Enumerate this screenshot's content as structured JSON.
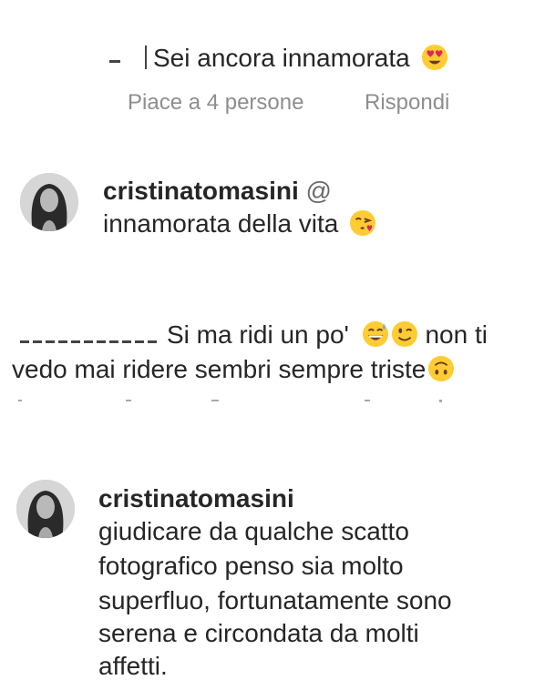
{
  "comment1": {
    "text": "Sei ancora innamorata",
    "emoji": "smiling-face-with-heart-eyes-icon",
    "likes_label": "Piace a 4 persone",
    "reply_label": "Rispondi"
  },
  "reply1": {
    "username": "cristinatomasini",
    "mention_prefix": "@",
    "text": "innamorata della vita",
    "emoji": "face-blowing-a-kiss-icon"
  },
  "comment2": {
    "line1": "Si ma ridi un po'",
    "line1_after": "non ti",
    "line2": "vedo mai ridere sembri sempre triste",
    "emojis": [
      "grinning-face-with-sweat-icon",
      "winking-face-icon",
      "upside-down-face-icon"
    ]
  },
  "reply2": {
    "username": "cristinatomasini",
    "lines": [
      "giudicare da qualche scatto",
      "fotografico penso sia molto",
      "superfluo, fortunatamente sono",
      "serena e circondata da molti",
      "affetti."
    ]
  },
  "colors": {
    "text": "#262626",
    "meta": "#8e8e8e",
    "emoji_yellow": "#ffcc33",
    "heart_red": "#e0245e"
  }
}
